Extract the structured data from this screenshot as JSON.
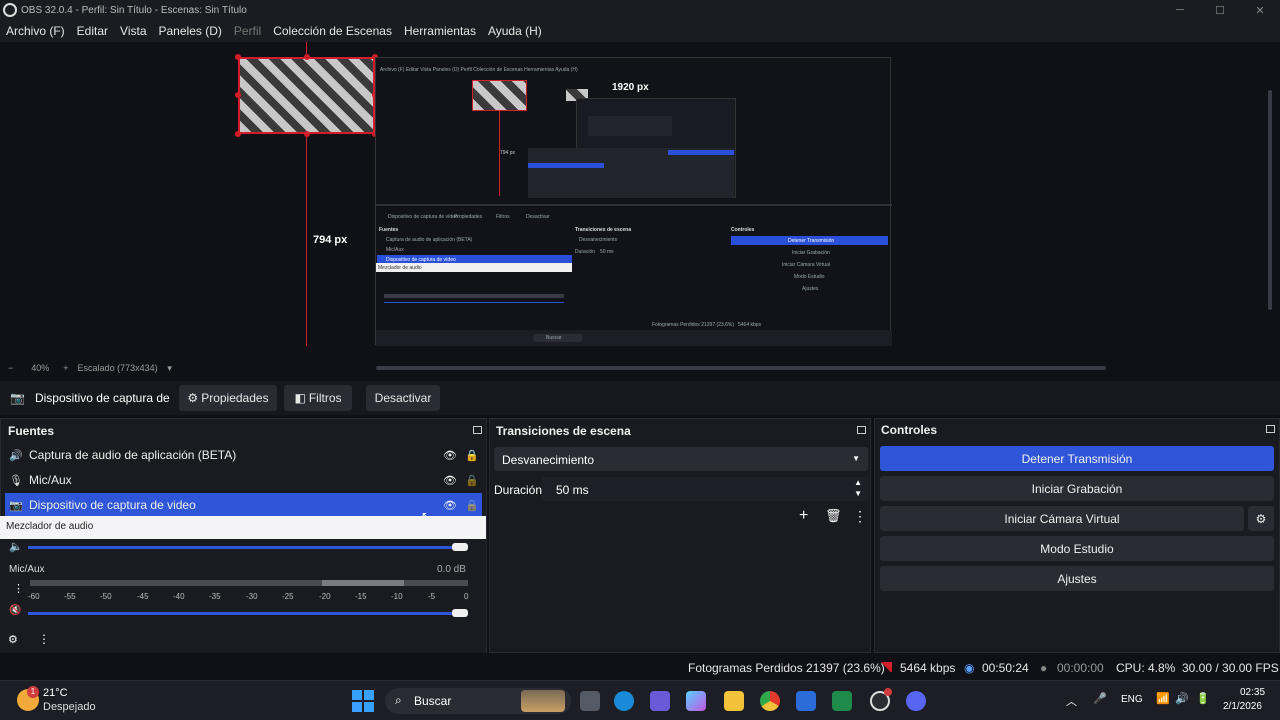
{
  "window": {
    "title": "OBS 32.0.4 - Perfil: Sin Título - Escenas: Sin Título"
  },
  "menu": [
    "Archivo (F)",
    "Editar",
    "Vista",
    "Paneles (D)",
    "Perfil",
    "Colección de Escenas",
    "Herramientas",
    "Ayuda (H)"
  ],
  "preview": {
    "width_label": "1920 px",
    "height_label": "794 px",
    "inner_height_label": "794 px",
    "mini_menu": "Archivo (F)  Editar  Vista  Paneles (D)  Perfil  Colección de Escenas  Herramientas  Ayuda (H)",
    "mini_src_label": "Dispositivo de captura de vídeo",
    "mini_props": "Propiedades",
    "mini_filters": "Filtros",
    "mini_deact": "Desactivar",
    "mini_fuentes": "Fuentes",
    "mini_trans": "Transiciones de escena",
    "mini_controles": "Controles",
    "mini_src1": "Captura de audio de aplicación (BETA)",
    "mini_src2": "Mic/Aux",
    "mini_src3": "Dispositivo de captura de vídeo",
    "mini_mixer": "Mezclador de audio",
    "mini_fade": "Desvanecimiento",
    "mini_dur": "Duración",
    "mini_dur_val": "50 ms",
    "mini_stop": "Detener Transmisión",
    "mini_rec": "Iniciar Grabación",
    "mini_vcam": "Iniciar Cámara Virtual",
    "mini_studio": "Modo Estudio",
    "mini_settings": "Ajustes",
    "mini_status": "Fotogramas Perdidos 21397 (23.6%)",
    "mini_kbps": "5464 kbps",
    "mini_search": "Buscar"
  },
  "zoom": {
    "minus": "−",
    "value": "40%",
    "plus": "+",
    "scale": "Escalado (773x434)"
  },
  "source_toolbar": {
    "source_name": "Dispositivo de captura de v",
    "properties": "Propiedades",
    "filters": "Filtros",
    "deactivate": "Desactivar"
  },
  "sources": {
    "title": "Fuentes",
    "items": [
      {
        "label": "Captura de audio de aplicación (BETA)",
        "icon": "speaker-icon"
      },
      {
        "label": "Mic/Aux",
        "icon": "mic-icon"
      },
      {
        "label": "Dispositivo de captura de video",
        "icon": "camera-icon"
      }
    ]
  },
  "mixer": {
    "title": "Mezclador de audio",
    "channel": "Mic/Aux",
    "db": "0.0 dB",
    "scale": [
      "-60",
      "-55",
      "-50",
      "-45",
      "-40",
      "-35",
      "-30",
      "-25",
      "-20",
      "-15",
      "-10",
      "-5",
      "0"
    ]
  },
  "transitions": {
    "title": "Transiciones de escena",
    "selected": "Desvanecimiento",
    "duration_label": "Duración",
    "duration_value": "50 ms"
  },
  "controls": {
    "title": "Controles",
    "stop_stream": "Detener Transmisión",
    "start_recording": "Iniciar Grabación",
    "start_vcam": "Iniciar Cámara Virtual",
    "studio_mode": "Modo Estudio",
    "settings": "Ajustes"
  },
  "status": {
    "dropped": "Fotogramas Perdidos 21397 (23.6%)",
    "kbps": "5464 kbps",
    "stream_time": "00:50:24",
    "rec_time": "00:00:00",
    "cpu": "CPU: 4.8%",
    "fps": "30.00 / 30.00 FPS"
  },
  "taskbar": {
    "weather_temp": "21°C",
    "weather_desc": "Despejado",
    "weather_badge": "1",
    "search": "Buscar",
    "lang": "ENG",
    "time": "02:35",
    "date": "2/1/2026"
  },
  "colors": {
    "accent": "#2f56d8",
    "red": "#d21e2b",
    "bg": "#101117",
    "panel": "#1a1b21"
  }
}
